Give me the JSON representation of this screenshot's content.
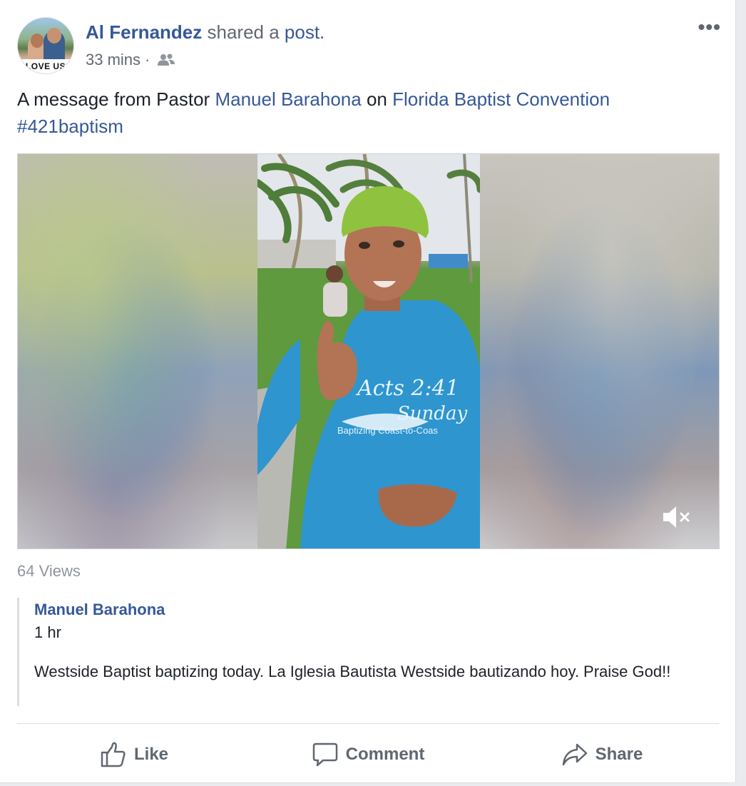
{
  "post": {
    "author": "Al Fernandez",
    "action": "shared a",
    "object_link": "post.",
    "time": "33 mins",
    "separator": "·",
    "privacy_icon": "friends-icon",
    "more_label": "•••",
    "avatar_text": "LOVE US"
  },
  "message": {
    "part1": "A message from Pastor ",
    "pastor_link": "Manuel Barahona",
    "part2": " on ",
    "page_link": "Florida Baptist Convention",
    "hashtag": "#421baptism"
  },
  "video": {
    "shirt_line1": "Acts 2:41",
    "shirt_line2": "Sunday",
    "shirt_line3": "Baptizing Coast-to-Coas",
    "mute_icon": "volume-muted-icon",
    "views": "64 Views"
  },
  "shared_post": {
    "author": "Manuel Barahona",
    "time": "1 hr",
    "text": "Westside Baptist baptizing today. La Iglesia Bautista Westside bautizando hoy. Praise God!!"
  },
  "actions": {
    "like": "Like",
    "comment": "Comment",
    "share": "Share"
  },
  "colors": {
    "link": "#365899",
    "secondary_text": "#616770",
    "background": "#e9ebee"
  }
}
